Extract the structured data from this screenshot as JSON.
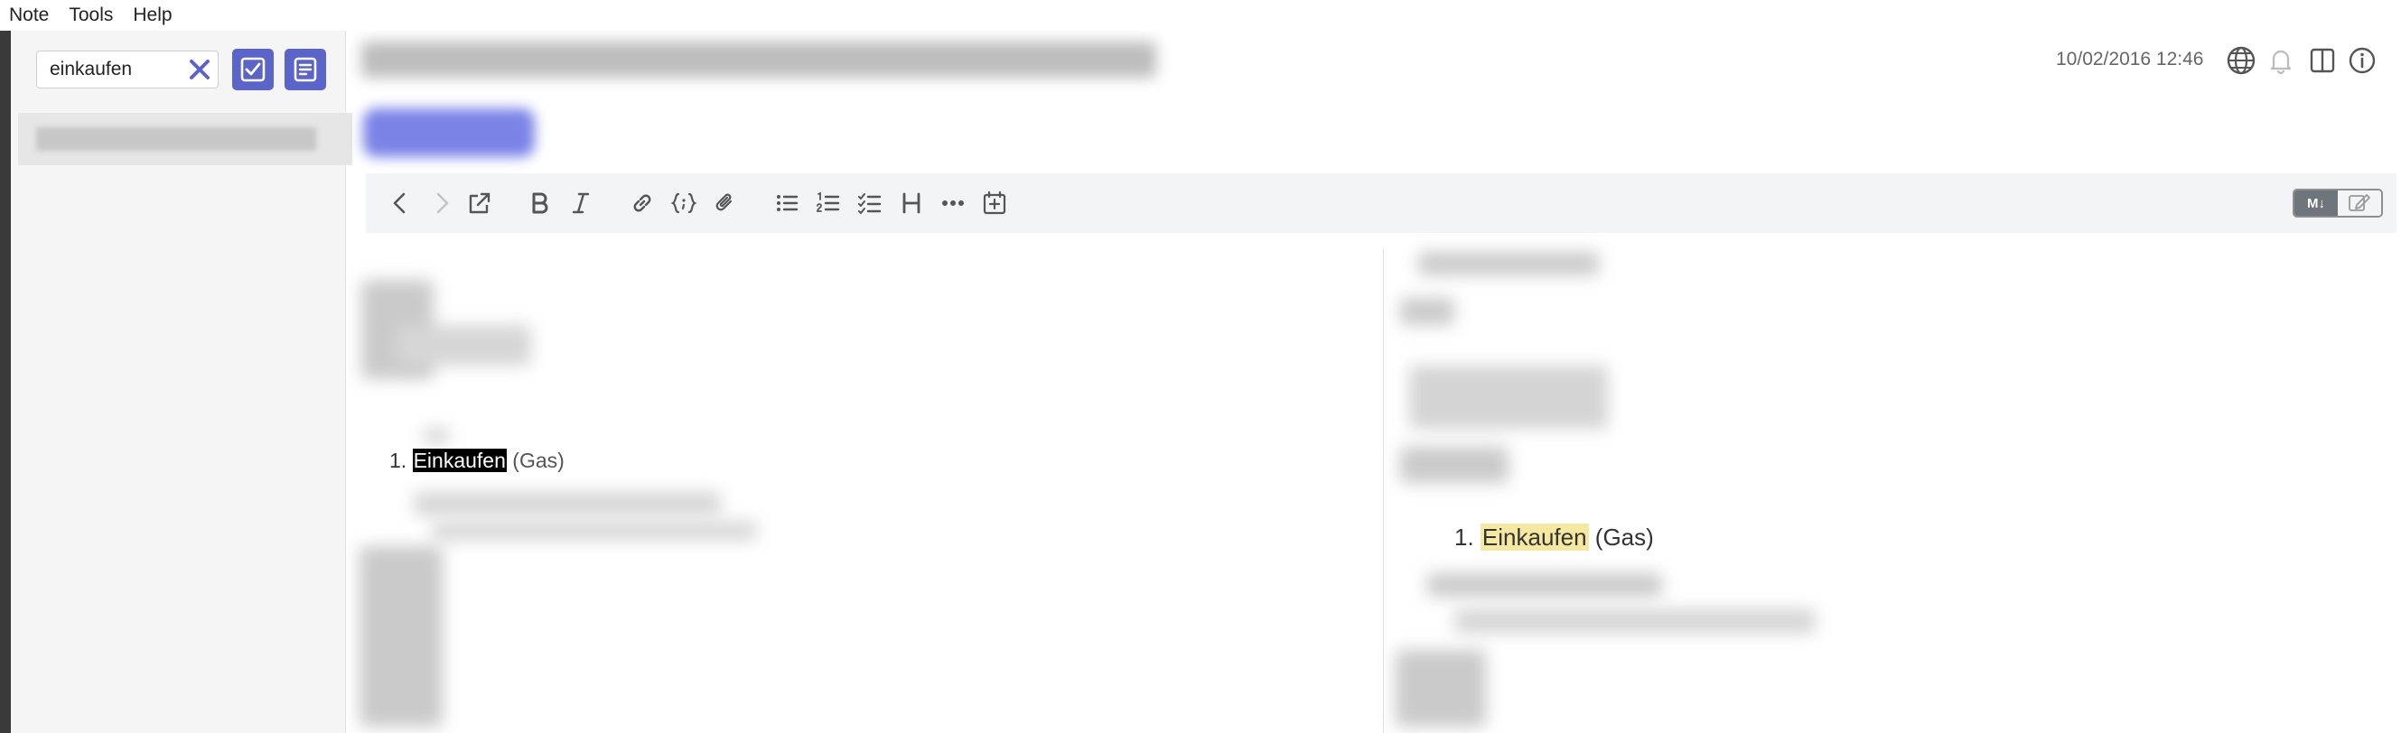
{
  "menu": {
    "note": "Note",
    "tools": "Tools",
    "help": "Help"
  },
  "sidebar": {
    "search": {
      "value": "einkaufen"
    },
    "icons": {
      "clear": "close-icon",
      "check": "checkbox-icon",
      "note": "note-icon"
    }
  },
  "note": {
    "date": "10/02/2016 12:46",
    "icons": [
      "globe-icon",
      "bell-icon",
      "split-view-icon",
      "info-icon"
    ]
  },
  "toolbar": {
    "icons": [
      "back-icon",
      "forward-icon",
      "open-external-icon",
      "bold-icon",
      "italic-icon",
      "link-icon",
      "code-block-icon",
      "attachment-icon",
      "bullet-list-icon",
      "numbered-list-icon",
      "checklist-icon",
      "heading-icon",
      "more-icon",
      "insert-date-icon"
    ],
    "mode_labels": {
      "markdown": "M↓"
    }
  },
  "editor": {
    "match": {
      "number": "1.",
      "highlight": "Einkaufen",
      "rest": " (Gas)"
    }
  },
  "preview": {
    "match": {
      "number": "1.",
      "highlight": "Einkaufen",
      "rest": " (Gas)"
    }
  },
  "colors": {
    "accent": "#5b64c8",
    "highlight_preview": "#f5e9a1",
    "highlight_editor": "#000000"
  }
}
